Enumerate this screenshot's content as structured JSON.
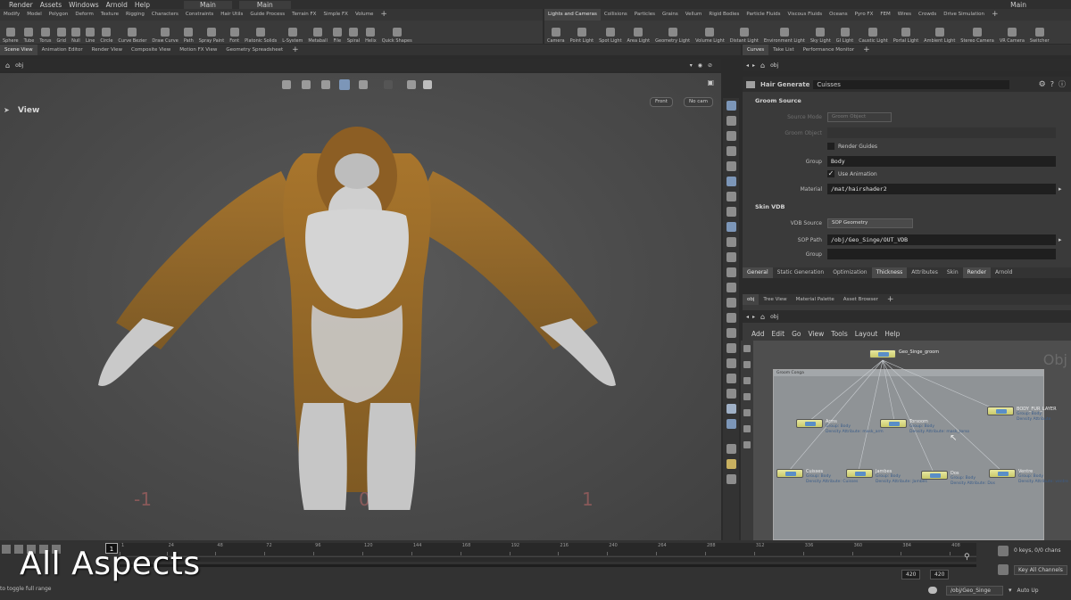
{
  "menu": {
    "items": [
      "Render",
      "Assets",
      "Windows",
      "Arnold",
      "Help"
    ],
    "desktop": "Main",
    "desktop2": "Main",
    "tab_label": "Main"
  },
  "shelf_left": {
    "tabs": [
      "Modify",
      "Model",
      "Polygon",
      "Deform",
      "Texture",
      "Rigging",
      "Characters",
      "Constraints",
      "Hair Utils",
      "Guide Process",
      "Terrain FX",
      "Simple FX",
      "Volume"
    ],
    "tools": [
      "Sphere",
      "Tube",
      "Torus",
      "Grid",
      "Null",
      "Line",
      "Circle",
      "Curve Bezier",
      "Draw Curve",
      "Path",
      "Spray Paint",
      "Font",
      "Platonic Solids",
      "L-System",
      "Metaball",
      "File",
      "Spiral",
      "Helix",
      "Quick Shapes"
    ]
  },
  "shelf_right": {
    "tabs": [
      "Lights and Cameras",
      "Collisions",
      "Particles",
      "Grains",
      "Vellum",
      "Rigid Bodies",
      "Particle Fluids",
      "Viscous Fluids",
      "Oceans",
      "Pyro FX",
      "FEM",
      "Wires",
      "Crowds",
      "Drive Simulation"
    ],
    "tools": [
      "Camera",
      "Point Light",
      "Spot Light",
      "Area Light",
      "Geometry Light",
      "Volume Light",
      "Distant Light",
      "Environment Light",
      "Sky Light",
      "GI Light",
      "Caustic Light",
      "Portal Light",
      "Ambient Light",
      "Stereo Camera",
      "VR Camera",
      "Switcher"
    ]
  },
  "pane_tabs_left": [
    "Scene View",
    "Animation Editor",
    "Render View",
    "Composite View",
    "Motion FX View",
    "Geometry Spreadsheet"
  ],
  "pane_tabs_right": [
    "Curves",
    "Take List",
    "Performance Monitor"
  ],
  "viewport": {
    "path": "obj",
    "label": "View",
    "camera_menu": "Front",
    "cam_menu": "No cam",
    "grid_numbers": [
      "-1",
      "0",
      "1"
    ]
  },
  "params": {
    "path": "obj",
    "node_type": "Hair Generate",
    "node_name": "Cuisses",
    "groom_source": {
      "title": "Groom Source",
      "source_mode_label": "Source Mode",
      "source_mode_value": "Groom Object",
      "groom_object_label": "Groom Object",
      "render_guides_label": "Render Guides",
      "group_label": "Group",
      "group_value": "Body",
      "use_animation_label": "Use Animation",
      "material_label": "Material",
      "material_value": "/mat/hairshader2"
    },
    "skin_vdb": {
      "title": "Skin VDB",
      "vdb_source_label": "VDB Source",
      "vdb_source_value": "SOP Geometry",
      "sop_path_label": "SOP Path",
      "sop_path_value": "/obj/Geo_Singe/OUT_VDB",
      "group_label": "Group"
    },
    "tabs": [
      "General",
      "Static Generation",
      "Optimization",
      "Thickness",
      "Attributes",
      "Skin",
      "Render",
      "Arnold"
    ],
    "active_tabs": [
      "General",
      "Thickness",
      "Render"
    ]
  },
  "network": {
    "tabs": [
      "obj",
      "Tree View",
      "Material Palette",
      "Asset Browser"
    ],
    "path": "obj",
    "menu": [
      "Add",
      "Edit",
      "Go",
      "View",
      "Tools",
      "Layout",
      "Help"
    ],
    "watermark": "Obj",
    "box_label": "Groom Conga",
    "top_node": "Geo_Singe_groom",
    "nodes": [
      {
        "name": "Arms",
        "sub1": "Group: Body",
        "sub2": "Density Attribute: mask_arm"
      },
      {
        "name": "Torsoom",
        "sub1": "Group: Body",
        "sub2": "Density Attribute: mask_torso"
      },
      {
        "name": "BODY_FUR_LAYER",
        "sub1": "Group: Body",
        "sub2": "Density Attribute"
      },
      {
        "name": "Cuisses",
        "sub1": "Group: Body",
        "sub2": "Density Attribute: Cuisses"
      },
      {
        "name": "Jambes",
        "sub1": "Group: Body",
        "sub2": "Density Attribute: Jambes"
      },
      {
        "name": "Dos",
        "sub1": "Group: Body",
        "sub2": "Density Attribute: Dos"
      },
      {
        "name": "Ventre",
        "sub1": "Group: Body",
        "sub2": "Density Attribute: ventre"
      }
    ]
  },
  "timeline": {
    "current_frame": "1",
    "ticks": [
      "1",
      "24",
      "48",
      "72",
      "96",
      "120",
      "144",
      "168",
      "192",
      "216",
      "240",
      "264",
      "288",
      "312",
      "336",
      "360",
      "384",
      "408"
    ],
    "end_frame": "420",
    "end_frame2": "420",
    "caption": "All Aspects",
    "status": "to toggle full range",
    "keys_label": "0 keys, 0/0 chans",
    "key_all_label": "Key All Channels",
    "auto_label": "Auto Up",
    "path_label": "/obj/Geo_Singe"
  }
}
